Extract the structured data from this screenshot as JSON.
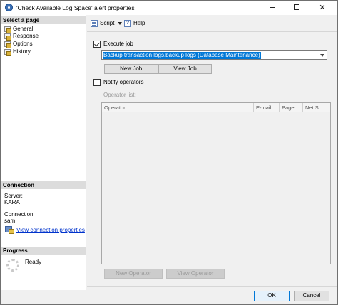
{
  "window": {
    "title": "'Check Available Log Space' alert properties",
    "minimize_label": "",
    "close_label": "✕"
  },
  "sidebar": {
    "select_page_header": "Select a page",
    "pages": [
      {
        "label": "General"
      },
      {
        "label": "Response"
      },
      {
        "label": "Options"
      },
      {
        "label": "History"
      }
    ],
    "connection_header": "Connection",
    "server_label": "Server:",
    "server_value": "KARA",
    "connection_label": "Connection:",
    "connection_value": "sam",
    "view_connection_link": "View connection properties",
    "progress_header": "Progress",
    "progress_status": "Ready"
  },
  "toolbar": {
    "script_label": "Script",
    "help_label": "Help"
  },
  "response": {
    "execute_job_label": "Execute job",
    "execute_job_checked": true,
    "job_value": "Backup transaction logs.backup logs (Database Maintenance)",
    "new_job_button": "New Job...",
    "view_job_button": "View Job",
    "notify_operators_label": "Notify operators",
    "notify_operators_checked": false,
    "operator_list_label": "Operator list:",
    "columns": [
      "Operator",
      "E-mail",
      "Pager",
      "Net S"
    ],
    "new_operator_button": "New Operator",
    "view_operator_button": "View Operator"
  },
  "footer": {
    "ok_button": "OK",
    "cancel_button": "Cancel"
  }
}
